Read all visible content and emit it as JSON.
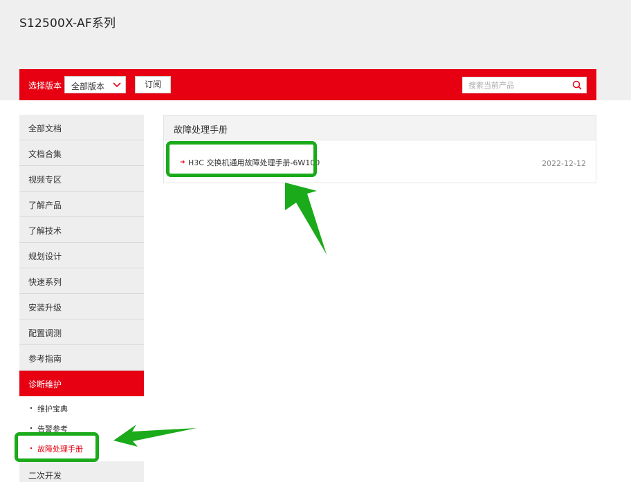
{
  "header": {
    "title": "S12500X-AF系列"
  },
  "toolbar": {
    "version_label": "选择版本",
    "version_selected": "全部版本",
    "subscribe_label": "订阅",
    "search_placeholder": "搜索当前产品"
  },
  "sidebar": {
    "items": [
      {
        "label": "全部文档"
      },
      {
        "label": "文档合集"
      },
      {
        "label": "视频专区"
      },
      {
        "label": "了解产品"
      },
      {
        "label": "了解技术"
      },
      {
        "label": "规划设计"
      },
      {
        "label": "快速系列"
      },
      {
        "label": "安装升级"
      },
      {
        "label": "配置调测"
      },
      {
        "label": "参考指南"
      },
      {
        "label": "诊断维护"
      }
    ],
    "subitems": [
      {
        "label": "维护宝典"
      },
      {
        "label": "告警参考"
      },
      {
        "label": "故障处理手册"
      }
    ],
    "bottom_item": "二次开发"
  },
  "main": {
    "section_title": "故障处理手册",
    "docs": [
      {
        "title": "H3C 交换机通用故障处理手册-6W100",
        "date": "2022-12-12"
      }
    ]
  },
  "colors": {
    "brand_red": "#e60012",
    "highlight_green": "#1aaa1a"
  },
  "icons": {
    "search": "search-icon",
    "dropdown": "chevron-down-icon",
    "doc_bullet": "arrow-right-icon"
  }
}
